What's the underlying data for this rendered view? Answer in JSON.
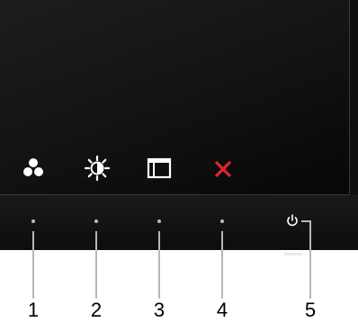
{
  "buttons": [
    {
      "number": "1",
      "icon": "preset-modes-icon"
    },
    {
      "number": "2",
      "icon": "brightness-contrast-icon"
    },
    {
      "number": "3",
      "icon": "menu-icon"
    },
    {
      "number": "4",
      "icon": "exit-icon"
    },
    {
      "number": "5",
      "icon": "power-icon"
    }
  ],
  "colors": {
    "exit_icon": "#e3252b",
    "icon_white": "#ffffff",
    "leader_line": "#b7b7b7"
  }
}
